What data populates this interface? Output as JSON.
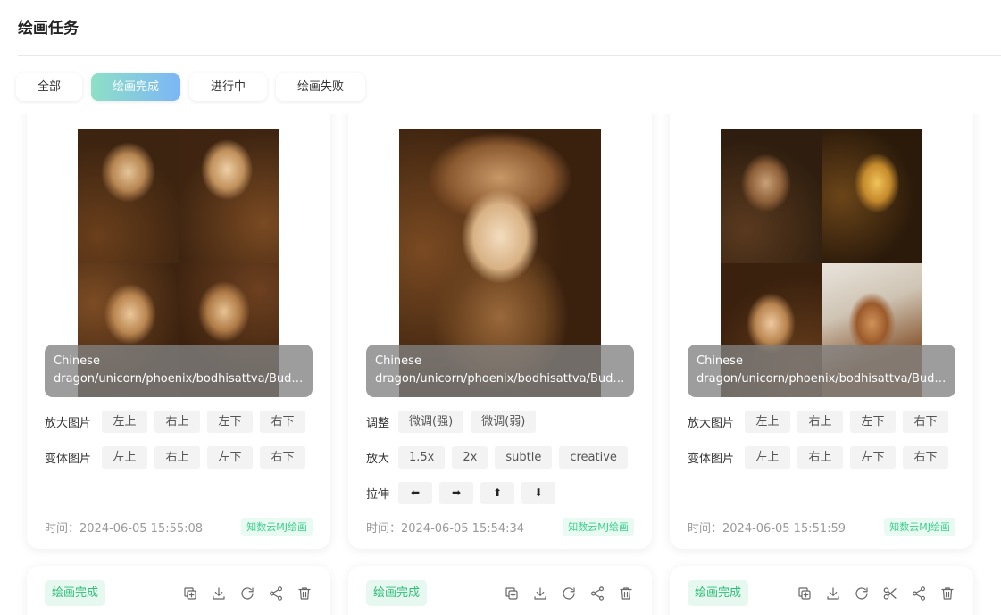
{
  "page": {
    "title": "绘画任务"
  },
  "tabs": [
    {
      "label": "全部",
      "active": false
    },
    {
      "label": "绘画完成",
      "active": true
    },
    {
      "label": "进行中",
      "active": false
    },
    {
      "label": "绘画失败",
      "active": false
    }
  ],
  "accent": {
    "gradient_start": "#8ee0c6",
    "gradient_end": "#7bb6f7",
    "status_green": "#2fbe78"
  },
  "cards": [
    {
      "prompt_line1": "Chinese",
      "prompt_line2": "dragon/unicorn/phoenix/bodhisattva/Budd...",
      "row1_label": "放大图片",
      "row1_buttons": [
        "左上",
        "右上",
        "左下",
        "右下"
      ],
      "row2_label": "变体图片",
      "row2_buttons": [
        "左上",
        "右上",
        "左下",
        "右下"
      ],
      "time": "时间：2024-06-05 15:55:08",
      "source": "知数云MJ绘画"
    },
    {
      "prompt_line1": "Chinese",
      "prompt_line2": "dragon/unicorn/phoenix/bodhisattva/Budd...",
      "adjust_label": "调整",
      "adjust_buttons": [
        "微调(强)",
        "微调(弱)"
      ],
      "zoom_label": "放大",
      "zoom_buttons": [
        "1.5x",
        "2x",
        "subtle",
        "creative"
      ],
      "pan_label": "拉伸",
      "pan_buttons": [
        "⬅",
        "➡",
        "⬆",
        "⬇"
      ],
      "time": "时间：2024-06-05 15:54:34",
      "source": "知数云MJ绘画"
    },
    {
      "prompt_line1": "Chinese",
      "prompt_line2": "dragon/unicorn/phoenix/bodhisattva/Budd...",
      "row1_label": "放大图片",
      "row1_buttons": [
        "左上",
        "右上",
        "左下",
        "右下"
      ],
      "row2_label": "变体图片",
      "row2_buttons": [
        "左上",
        "右上",
        "左下",
        "右下"
      ],
      "time": "时间：2024-06-05 15:51:59",
      "source": "知数云MJ绘画"
    }
  ],
  "next_cards": [
    {
      "status": "绘画完成",
      "actions": [
        "copy-icon",
        "download-icon",
        "refresh-icon",
        "share-icon",
        "delete-icon"
      ]
    },
    {
      "status": "绘画完成",
      "actions": [
        "copy-icon",
        "download-icon",
        "refresh-icon",
        "share-icon",
        "delete-icon"
      ]
    },
    {
      "status": "绘画完成",
      "actions": [
        "copy-icon",
        "download-icon",
        "refresh-icon",
        "scissors-icon",
        "share-icon",
        "delete-icon"
      ]
    }
  ]
}
